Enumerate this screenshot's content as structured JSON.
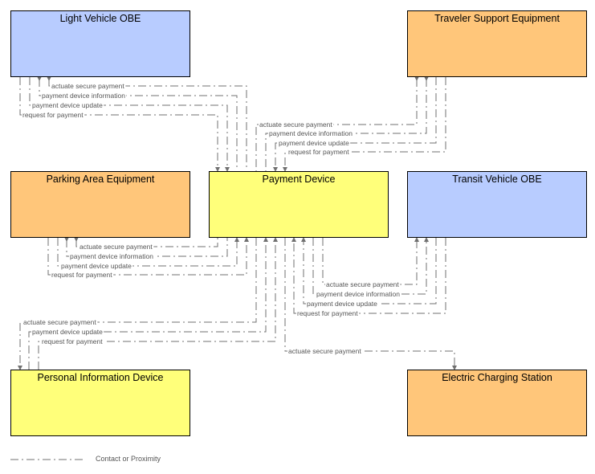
{
  "colors": {
    "blue": "#b8ccff",
    "orange": "#ffc67a",
    "yellow": "#ffff7a",
    "line": "#707070"
  },
  "boxes": {
    "light_vehicle_obe": {
      "label": "Light Vehicle OBE",
      "color": "blue"
    },
    "traveler_support_equipment": {
      "label": "Traveler Support Equipment",
      "color": "orange"
    },
    "parking_area_equipment": {
      "label": "Parking Area Equipment",
      "color": "orange"
    },
    "payment_device": {
      "label": "Payment Device",
      "color": "yellow"
    },
    "transit_vehicle_obe": {
      "label": "Transit Vehicle OBE",
      "color": "blue"
    },
    "personal_information_device": {
      "label": "Personal Information Device",
      "color": "yellow"
    },
    "electric_charging_station": {
      "label": "Electric Charging Station",
      "color": "orange"
    }
  },
  "flows": {
    "lvo": [
      "actuate secure payment",
      "payment device information",
      "payment device update",
      "request for payment"
    ],
    "tse": [
      "actuate secure payment",
      "payment device information",
      "payment device update",
      "request for payment"
    ],
    "pae": [
      "actuate secure payment",
      "payment device information",
      "payment device update",
      "request for payment"
    ],
    "tvo": [
      "actuate secure payment",
      "payment device information",
      "payment device update",
      "request for payment"
    ],
    "pid": [
      "actuate secure payment",
      "payment device update",
      "request for payment"
    ],
    "ecs": [
      "actuate secure payment"
    ]
  },
  "legend": {
    "label": "Contact or Proximity"
  }
}
